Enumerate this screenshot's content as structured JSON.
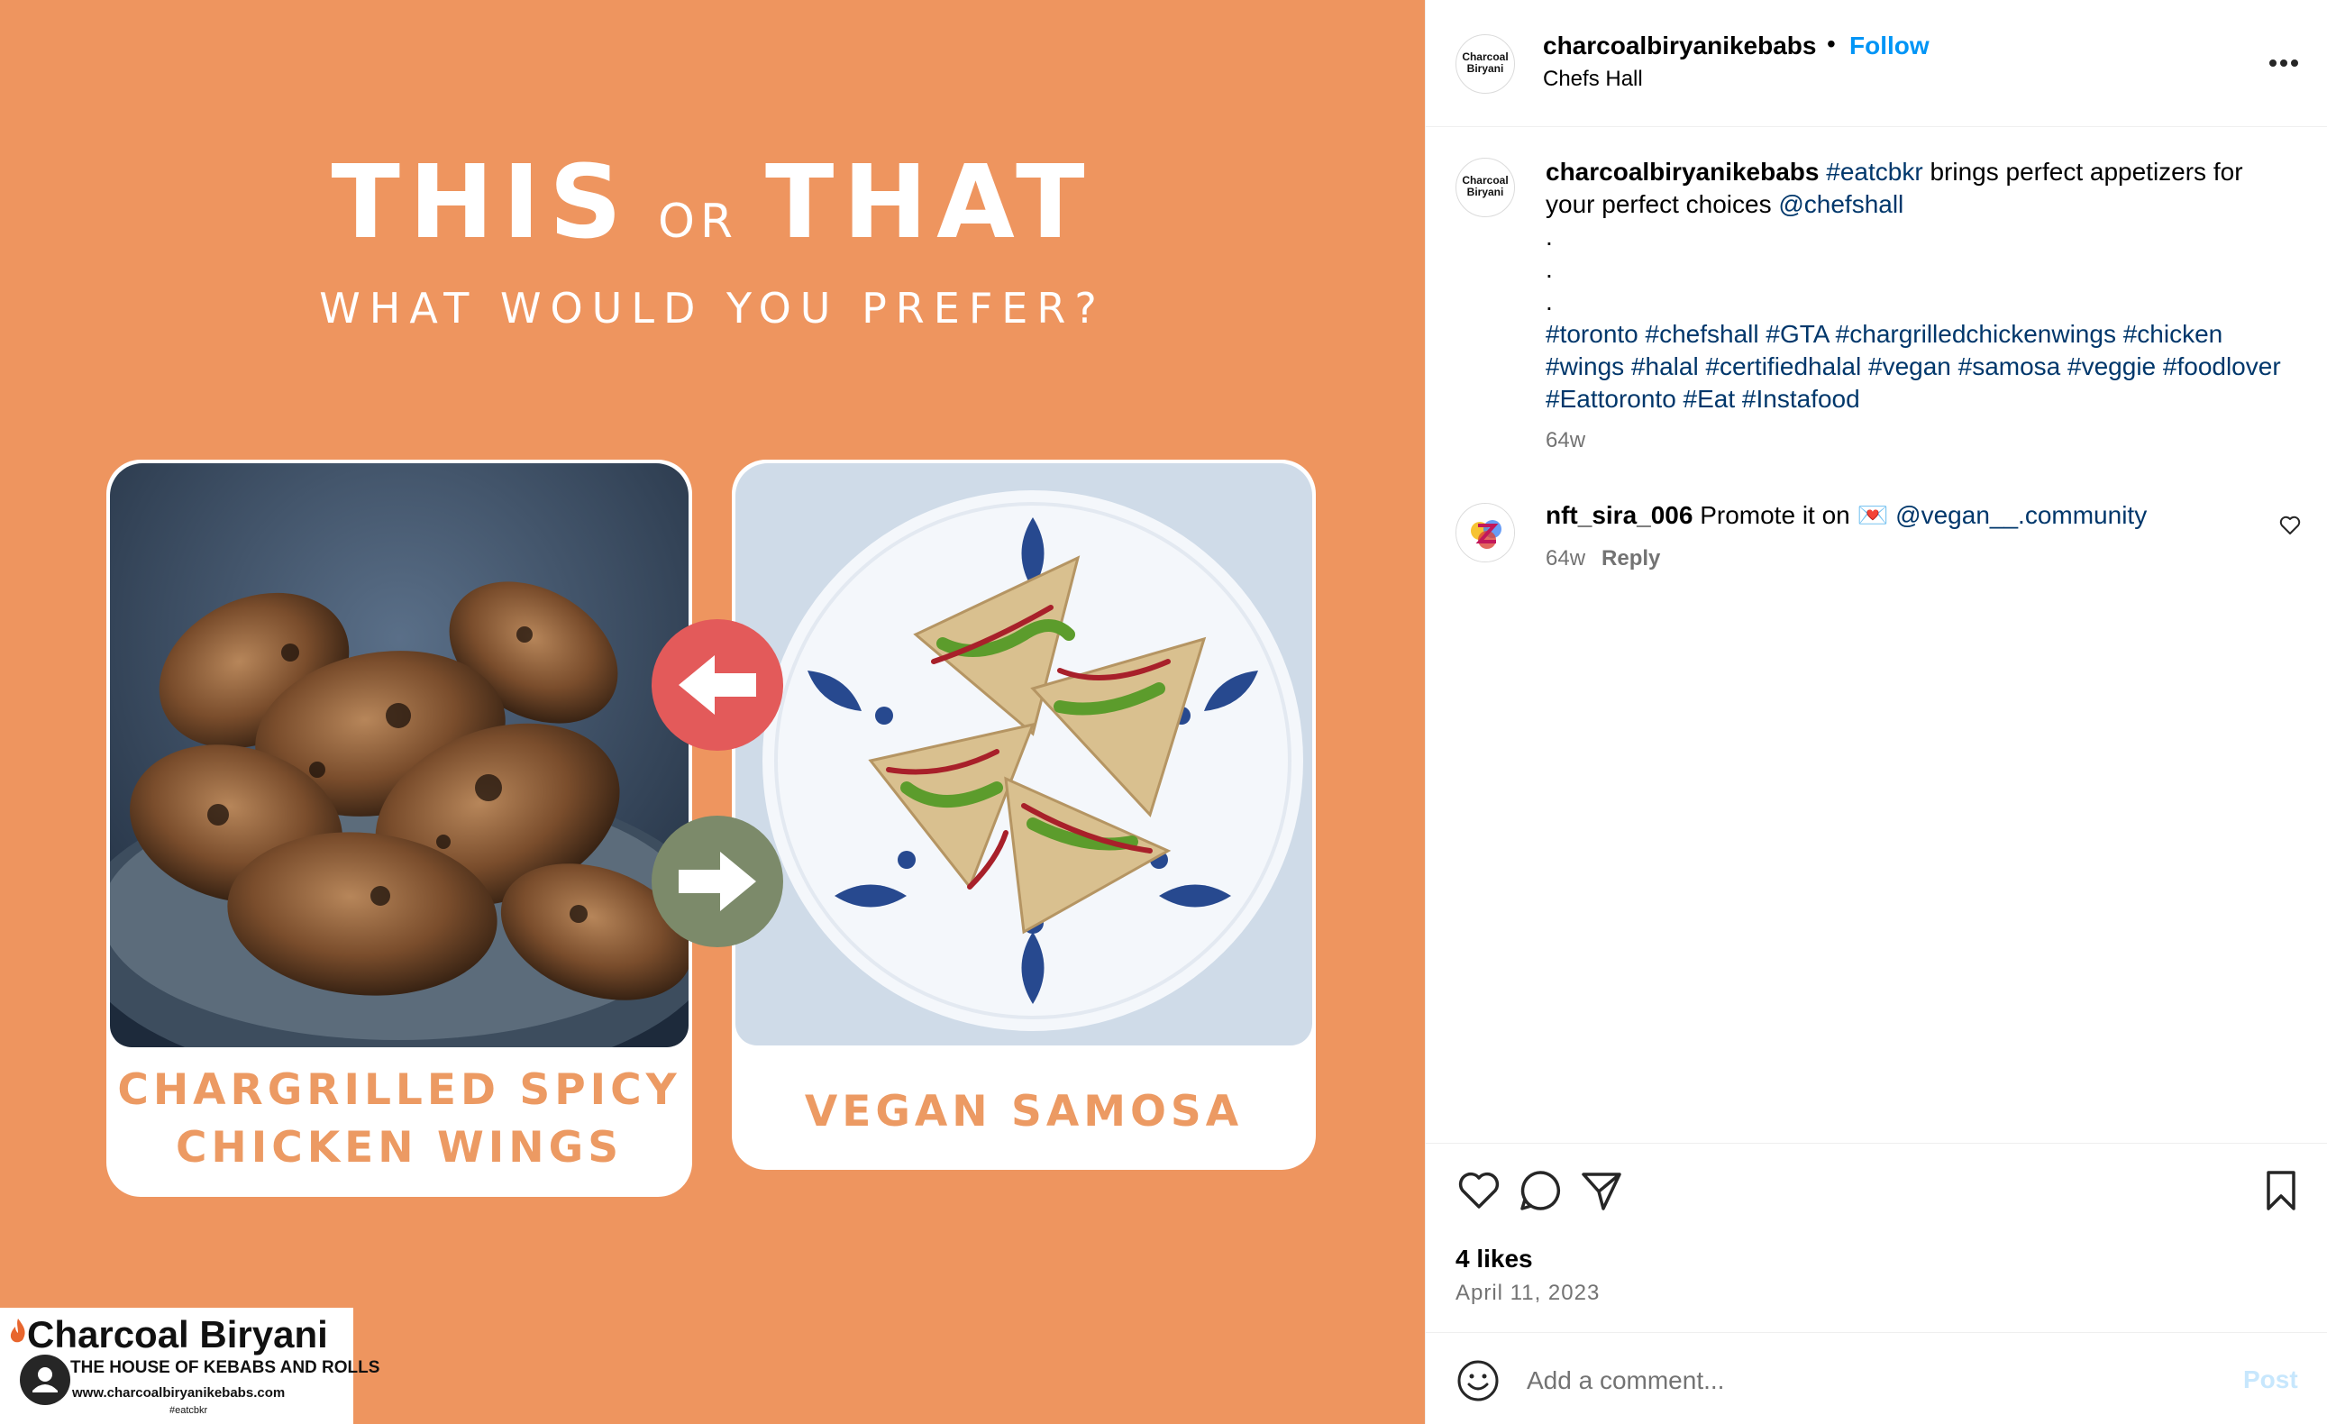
{
  "media": {
    "headline_this": "THIS",
    "headline_or": "OR",
    "headline_that": "THAT",
    "subheadline": "WHAT WOULD YOU PREFER?",
    "left_card": {
      "caption_line1": "CHARGRILLED SPICY",
      "caption_line2": "CHICKEN WINGS"
    },
    "right_card": {
      "caption": "VEGAN SAMOSA"
    },
    "left_arrow_icon": "arrow-left-icon",
    "right_arrow_icon": "arrow-right-icon",
    "brand": {
      "name": "Charcoal Biryani",
      "tagline": "THE HOUSE OF KEBABS AND ROLLS",
      "url": "www.charcoalbiryanikebabs.com",
      "hashtag": "#eatcbkr"
    },
    "colors": {
      "background": "#ee955f",
      "caption": "#ec9a63",
      "red_arrow": "#e35a5a",
      "green_arrow": "#7c8a6a"
    }
  },
  "post": {
    "header": {
      "username": "charcoalbiryanikebabs",
      "separator": "•",
      "follow_label": "Follow",
      "location": "Chefs Hall",
      "avatar_text": "Charcoal Biryani",
      "more_icon": "more-horizontal-icon"
    },
    "caption": {
      "username": "charcoalbiryanikebabs",
      "hashtag_main": "#eatcbkr",
      "text_1": " brings perfect appetizers for your perfect choices ",
      "mention": "@chefshall",
      "dot": ".",
      "hashtags": "#toronto #chefshall #GTA #chargrilledchickenwings #chicken #wings #halal #certifiedhalal #vegan #samosa #veggie #foodlover #Eattoronto #Eat #Instafood",
      "time": "64w"
    },
    "comments": [
      {
        "username": "nft_sira_006",
        "text": " Promote it on ",
        "emoji": "💌",
        "mention": " @vegan__.community",
        "time": "64w",
        "reply_label": "Reply"
      }
    ],
    "actions": {
      "like_icon": "heart-icon",
      "comment_icon": "comment-icon",
      "share_icon": "send-icon",
      "save_icon": "bookmark-icon",
      "likes": "4 likes",
      "date": "April 11, 2023"
    },
    "add_comment": {
      "placeholder": "Add a comment...",
      "post_label": "Post",
      "emoji_icon": "emoji-icon"
    },
    "colors": {
      "link": "#00376b",
      "follow": "#0095f6",
      "muted": "#737373",
      "post_disabled": "#c7e7fd"
    }
  }
}
